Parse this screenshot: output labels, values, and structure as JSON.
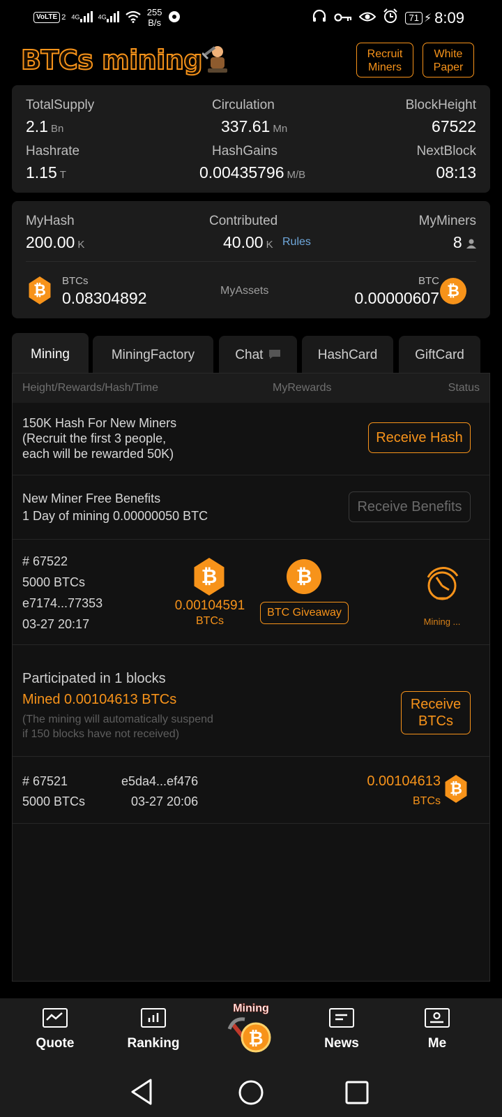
{
  "status_bar": {
    "volte": "VoLTE",
    "sim": "2",
    "net1": "4G",
    "net2": "4G",
    "speed_value": "255",
    "speed_unit": "B/s",
    "battery": "71",
    "time": "8:09"
  },
  "header": {
    "logo": "BTCs mining",
    "recruit_label": "Recruit Miners",
    "whitepaper_label": "White Paper"
  },
  "stats": {
    "total_supply_label": "TotalSupply",
    "total_supply_value": "2.1",
    "total_supply_unit": "Bn",
    "circulation_label": "Circulation",
    "circulation_value": "337.61",
    "circulation_unit": "Mn",
    "block_height_label": "BlockHeight",
    "block_height_value": "67522",
    "hashrate_label": "Hashrate",
    "hashrate_value": "1.15",
    "hashrate_unit": "T",
    "hash_gains_label": "HashGains",
    "hash_gains_value": "0.00435796",
    "hash_gains_unit": "M/B",
    "next_block_label": "NextBlock",
    "next_block_value": "08:13"
  },
  "my": {
    "my_hash_label": "MyHash",
    "my_hash_value": "200.00",
    "my_hash_unit": "K",
    "contributed_label": "Contributed",
    "contributed_value": "40.00",
    "contributed_unit": "K",
    "rules_label": "Rules",
    "my_miners_label": "MyMiners",
    "my_miners_value": "8",
    "btcs_label": "BTCs",
    "btcs_value": "0.08304892",
    "assets_label": "MyAssets",
    "btc_label": "BTC",
    "btc_value": "0.00000607"
  },
  "tabs": [
    "Mining",
    "MiningFactory",
    "Chat",
    "HashCard",
    "GiftCard"
  ],
  "table_head": {
    "col1": "Height/Rewards/Hash/Time",
    "col2": "MyRewards",
    "col3": "Status"
  },
  "promo1": {
    "line1": "150K Hash For New Miners",
    "line2": "(Recruit the first 3 people,",
    "line3": "each will be rewarded 50K)",
    "button": "Receive Hash"
  },
  "promo2": {
    "line1": "New Miner Free Benefits",
    "line2": "1 Day of mining 0.00000050 BTC",
    "button": "Receive Benefits"
  },
  "current_block": {
    "height": "# 67522",
    "reward": "5000 BTCs",
    "hash": "e7174...77353",
    "time": "03-27 20:17",
    "my_reward": "0.00104591",
    "my_reward_unit": "BTCs",
    "giveaway_button": "BTC Giveaway",
    "status": "Mining ..."
  },
  "summary": {
    "participated": "Participated in 1 blocks",
    "mined": "Mined 0.00104613 BTCs",
    "note1": "(The mining will automatically suspend",
    "note2": "if 150 blocks have not received)",
    "button_line1": "Receive",
    "button_line2": "BTCs"
  },
  "past_block": {
    "height": "# 67521",
    "reward": "5000 BTCs",
    "hash": "e5da4...ef476",
    "time": "03-27 20:06",
    "amount": "0.00104613",
    "unit": "BTCs"
  },
  "bottom_nav": {
    "quote": "Quote",
    "ranking": "Ranking",
    "mining": "Mining",
    "news": "News",
    "me": "Me"
  },
  "colors": {
    "accent": "#f7931a",
    "background": "#000000",
    "card": "#1c1c1c"
  }
}
